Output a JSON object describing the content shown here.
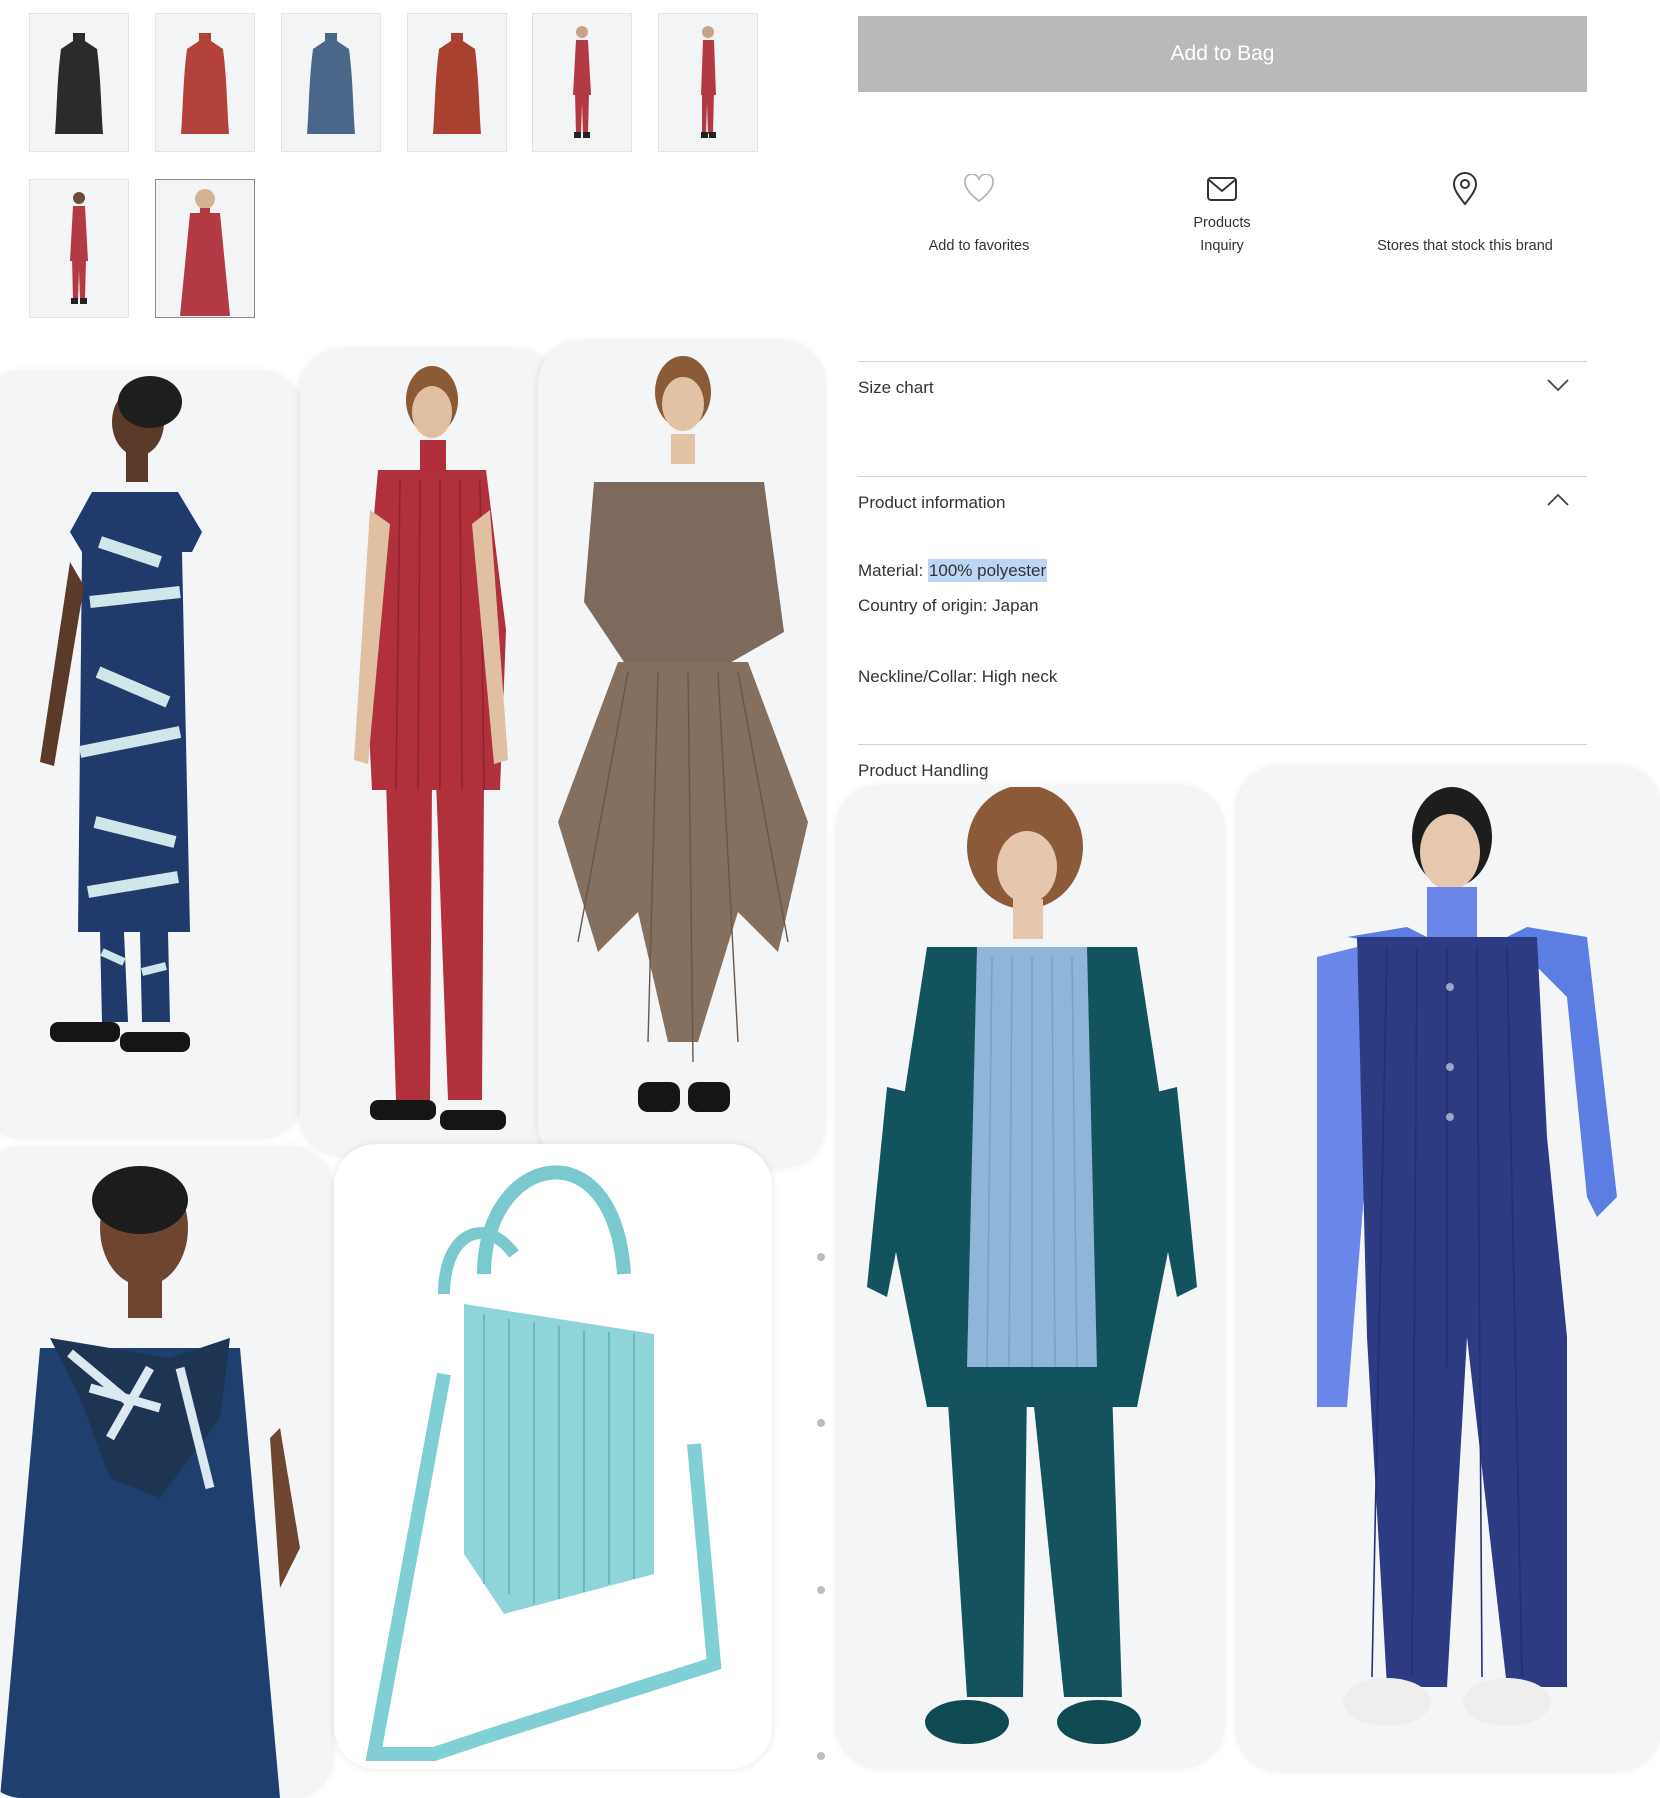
{
  "add_to_bag": "Add to Bag",
  "actions": {
    "favorites": "Add to favorites",
    "inquiry_line1": "Products",
    "inquiry_line2": "Inquiry",
    "stores": "Stores that stock this brand"
  },
  "accordion": {
    "size_chart": "Size chart",
    "product_information": "Product information",
    "product_handling": "Product Handling"
  },
  "product_info": {
    "material_label": "Material: ",
    "material_value": "100% polyester",
    "origin": "Country of origin: Japan",
    "neckline": "Neckline/Collar: High neck"
  },
  "thumbnails": [
    {
      "name": "thumb-black",
      "color": "#2b2b2b"
    },
    {
      "name": "thumb-red",
      "color": "#b2423a"
    },
    {
      "name": "thumb-blue",
      "color": "#4a6688"
    },
    {
      "name": "thumb-rust",
      "color": "#a8412f"
    },
    {
      "name": "thumb-model-front",
      "color": "#b23a45"
    },
    {
      "name": "thumb-model-side",
      "color": "#b23a45"
    },
    {
      "name": "thumb-model-back",
      "color": "#b23a45"
    },
    {
      "name": "thumb-model-closeup",
      "color": "#b23a45"
    }
  ],
  "colors": {
    "button_bg": "#b9b9b9",
    "highlight": "#bcd5f5",
    "divider": "#d3d3d3"
  },
  "icons": [
    "heart-icon",
    "envelope-icon",
    "map-pin-icon",
    "chevron-down-icon",
    "chevron-up-icon"
  ]
}
